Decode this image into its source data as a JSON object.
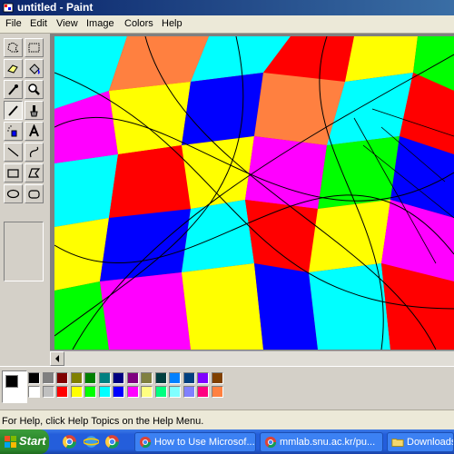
{
  "window": {
    "title": "untitled - Paint"
  },
  "menu": [
    "File",
    "Edit",
    "View",
    "Image",
    "Colors",
    "Help"
  ],
  "tools": [
    {
      "name": "free-form-select-icon"
    },
    {
      "name": "select-icon"
    },
    {
      "name": "eraser-icon"
    },
    {
      "name": "fill-bucket-icon"
    },
    {
      "name": "pick-color-icon"
    },
    {
      "name": "magnifier-icon"
    },
    {
      "name": "pencil-icon",
      "active": true
    },
    {
      "name": "brush-icon"
    },
    {
      "name": "airbrush-icon"
    },
    {
      "name": "text-icon",
      "glyph": "A"
    },
    {
      "name": "line-icon"
    },
    {
      "name": "curve-icon"
    },
    {
      "name": "rectangle-icon"
    },
    {
      "name": "polygon-icon"
    },
    {
      "name": "ellipse-icon"
    },
    {
      "name": "rounded-rectangle-icon"
    }
  ],
  "palette": {
    "foreground": "#000000",
    "background": "#ffffff",
    "row1": [
      "#000000",
      "#808080",
      "#800000",
      "#808000",
      "#008000",
      "#008080",
      "#000080",
      "#800080",
      "#808040",
      "#004040",
      "#0080ff",
      "#004080",
      "#8000ff",
      "#804000"
    ],
    "row2": [
      "#ffffff",
      "#c0c0c0",
      "#ff0000",
      "#ffff00",
      "#00ff00",
      "#00ffff",
      "#0000ff",
      "#ff00ff",
      "#ffff80",
      "#00ff80",
      "#80ffff",
      "#8080ff",
      "#ff0080",
      "#ff8040"
    ]
  },
  "status": {
    "text": "For Help, click Help Topics on the Help Menu."
  },
  "taskbar": {
    "start_label": "Start",
    "tasks": [
      "How to Use Microsof...",
      "mmlab.snu.ac.kr/pu...",
      "Downloads"
    ]
  }
}
